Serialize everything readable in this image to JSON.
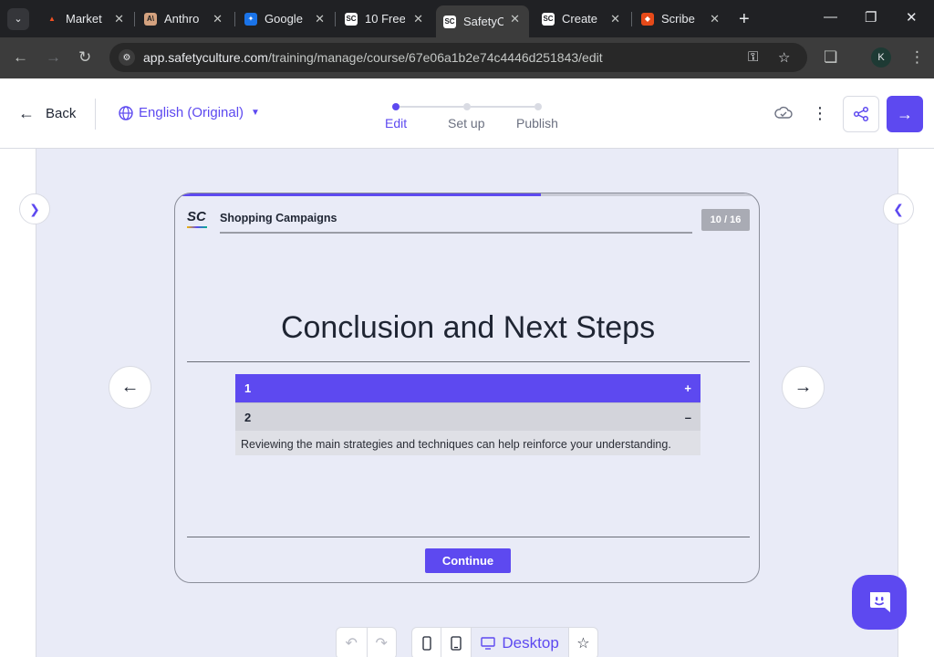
{
  "browser": {
    "tabs": [
      {
        "title": "Market",
        "favicon": "market-favicon",
        "color": "#f25022"
      },
      {
        "title": "Anthro",
        "favicon": "anthropic-favicon",
        "color": "#d4a27f"
      },
      {
        "title": "Google",
        "favicon": "google-favicon",
        "color": "#4285f4"
      },
      {
        "title": "10 Free",
        "favicon": "safetyculture-favicon",
        "color": "#ffffff"
      },
      {
        "title": "SafetyC",
        "favicon": "safetyculture-favicon",
        "color": "#ffffff"
      },
      {
        "title": "Create",
        "favicon": "safetyculture-favicon",
        "color": "#ffffff"
      },
      {
        "title": "Scribe",
        "favicon": "scribe-favicon",
        "color": "#e64a19"
      }
    ],
    "active_tab": 4,
    "url_host": "app.safetyculture.com",
    "url_path": "/training/manage/course/67e06a1b2e74c4446d251843/edit",
    "profile_initial": "K"
  },
  "header": {
    "back_label": "Back",
    "language": "English (Original)",
    "steps": [
      {
        "label": "Edit",
        "active": true
      },
      {
        "label": "Set up",
        "active": false
      },
      {
        "label": "Publish",
        "active": false
      }
    ],
    "accent": "#5d49f0"
  },
  "slide": {
    "logo_text": "SC",
    "course_title": "Shopping Campaigns",
    "page_indicator": "10 / 16",
    "progress": 0.625,
    "title": "Conclusion and Next Steps",
    "accordion": [
      {
        "label": "1",
        "state": "open",
        "toggle": "+"
      },
      {
        "label": "2",
        "state": "closed",
        "toggle": "–"
      }
    ],
    "accordion_body": "Reviewing the main strategies and techniques can help reinforce your understanding.",
    "continue_label": "Continue"
  },
  "bottom": {
    "view_label": "Desktop"
  }
}
